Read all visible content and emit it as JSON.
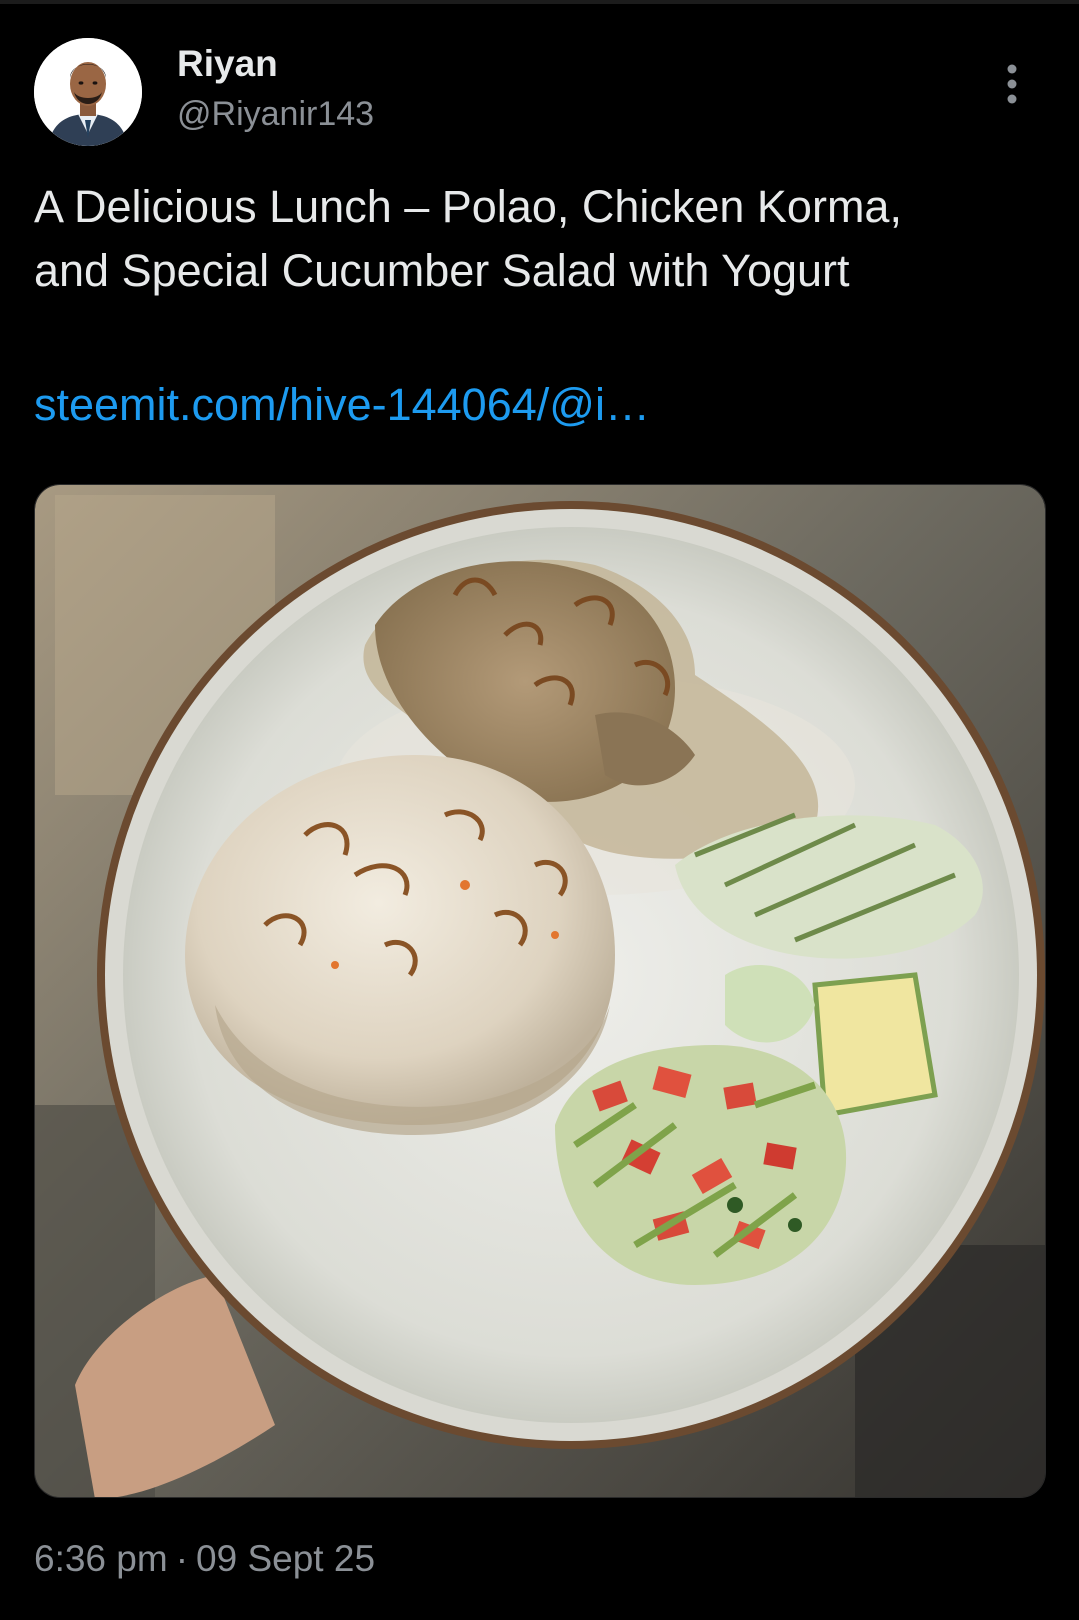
{
  "author": {
    "name": "Riyan",
    "handle": "@Riyanir143"
  },
  "tweet": {
    "text_line_1": "A Delicious Lunch – Polao, Chicken Korma,",
    "text_line_2": "and Special Cucumber Salad with Yogurt",
    "link": "steemit.com/hive-144064/@i…",
    "time": "6:36 pm",
    "separator": "·",
    "date": "09 Sept 25"
  },
  "icons": {
    "more": "more-vertical-icon",
    "avatar": "user-profile-photo"
  },
  "colors": {
    "background": "#000000",
    "text": "#e7e9ea",
    "secondary_text": "#8b9096",
    "link": "#1d9bf0"
  }
}
